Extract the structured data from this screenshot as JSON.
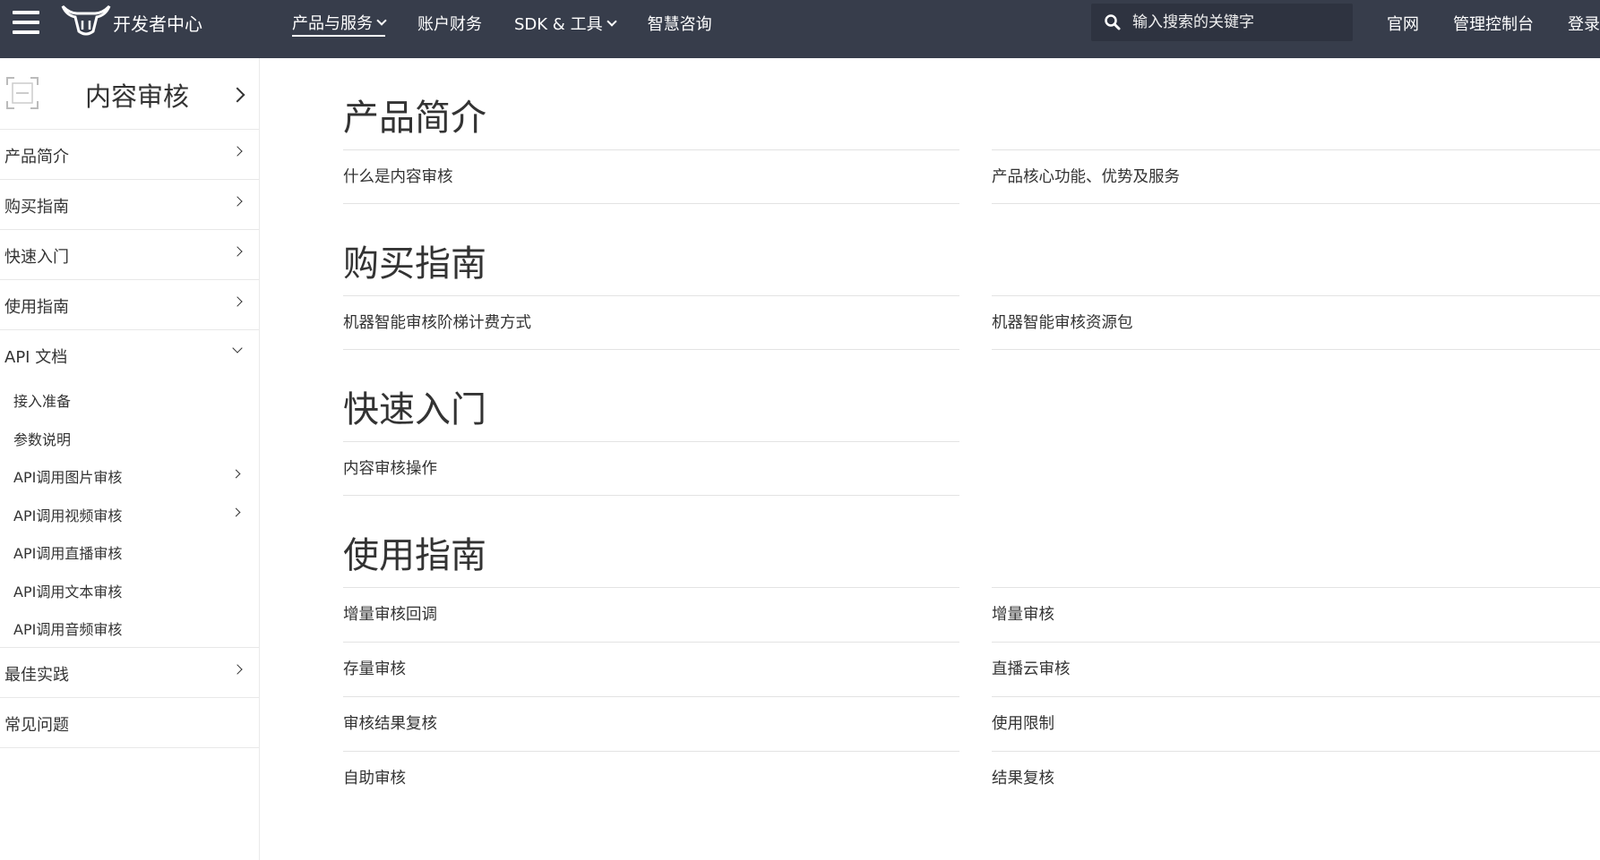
{
  "header": {
    "logo_text": "开发者中心",
    "nav": [
      {
        "label": "产品与服务",
        "has_caret": true,
        "active": true
      },
      {
        "label": "账户财务",
        "has_caret": false,
        "active": false
      },
      {
        "label": "SDK & 工具",
        "has_caret": true,
        "active": false
      },
      {
        "label": "智慧咨询",
        "has_caret": false,
        "active": false
      }
    ],
    "search_placeholder": "输入搜索的关键字",
    "links": [
      "官网",
      "管理控制台",
      "登录"
    ],
    "colors": {
      "bar": "#373d4b",
      "search_bg": "#2e3340"
    }
  },
  "sidebar": {
    "title": "内容审核",
    "items": [
      {
        "label": "产品简介"
      },
      {
        "label": "购买指南"
      },
      {
        "label": "快速入门"
      },
      {
        "label": "使用指南"
      },
      {
        "label": "API 文档",
        "expanded": true,
        "children": [
          {
            "label": "接入准备",
            "has_chevron": false
          },
          {
            "label": "参数说明",
            "has_chevron": false
          },
          {
            "label": "API调用图片审核",
            "has_chevron": true
          },
          {
            "label": "API调用视频审核",
            "has_chevron": true
          },
          {
            "label": "API调用直播审核",
            "has_chevron": false
          },
          {
            "label": "API调用文本审核",
            "has_chevron": false
          },
          {
            "label": "API调用音频审核",
            "has_chevron": false
          }
        ]
      },
      {
        "label": "最佳实践"
      },
      {
        "label": "常见问题"
      }
    ]
  },
  "sections": [
    {
      "title": "产品简介",
      "links": [
        "什么是内容审核",
        "产品核心功能、优势及服务"
      ]
    },
    {
      "title": "购买指南",
      "links": [
        "机器智能审核阶梯计费方式",
        "机器智能审核资源包"
      ]
    },
    {
      "title": "快速入门",
      "links": [
        "内容审核操作"
      ]
    },
    {
      "title": "使用指南",
      "links": [
        "增量审核回调",
        "增量审核",
        "存量审核",
        "直播云审核",
        "审核结果复核",
        "使用限制",
        "自助审核",
        "结果复核"
      ]
    }
  ]
}
